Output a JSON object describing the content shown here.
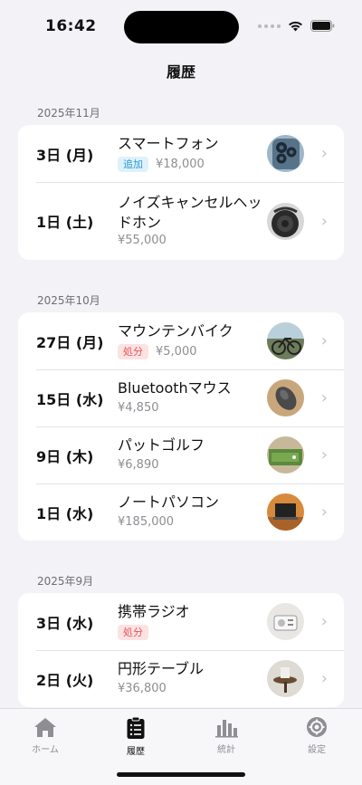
{
  "status": {
    "time": "16:42"
  },
  "nav": {
    "title": "履歴"
  },
  "sections": [
    {
      "header": "2025年11月",
      "items": [
        {
          "date": "3日 (月)",
          "name": "スマートフォン",
          "badge": "追加",
          "price": "¥18,000"
        },
        {
          "date": "1日 (土)",
          "name": "ノイズキャンセルヘッドホン",
          "price": "¥55,000"
        }
      ]
    },
    {
      "header": "2025年10月",
      "items": [
        {
          "date": "27日 (月)",
          "name": "マウンテンバイク",
          "badge": "処分",
          "price": "¥5,000"
        },
        {
          "date": "15日 (水)",
          "name": "Bluetoothマウス",
          "price": "¥4,850"
        },
        {
          "date": "9日 (木)",
          "name": "パットゴルフ",
          "price": "¥6,890"
        },
        {
          "date": "1日 (水)",
          "name": "ノートパソコン",
          "price": "¥185,000"
        }
      ]
    },
    {
      "header": "2025年9月",
      "items": [
        {
          "date": "3日 (水)",
          "name": "携帯ラジオ",
          "badge": "処分"
        },
        {
          "date": "2日 (火)",
          "name": "円形テーブル",
          "price": "¥36,800"
        }
      ]
    }
  ],
  "tabs": [
    {
      "label": "ホーム",
      "icon": "house-icon"
    },
    {
      "label": "履歴",
      "icon": "clipboard-list-icon",
      "active": true
    },
    {
      "label": "統計",
      "icon": "bar-chart-icon"
    },
    {
      "label": "設定",
      "icon": "gear-icon"
    }
  ],
  "colors": {
    "background": "#f2f2f7",
    "add_badge": "#2c9ad6",
    "dispose_badge": "#e05656"
  }
}
